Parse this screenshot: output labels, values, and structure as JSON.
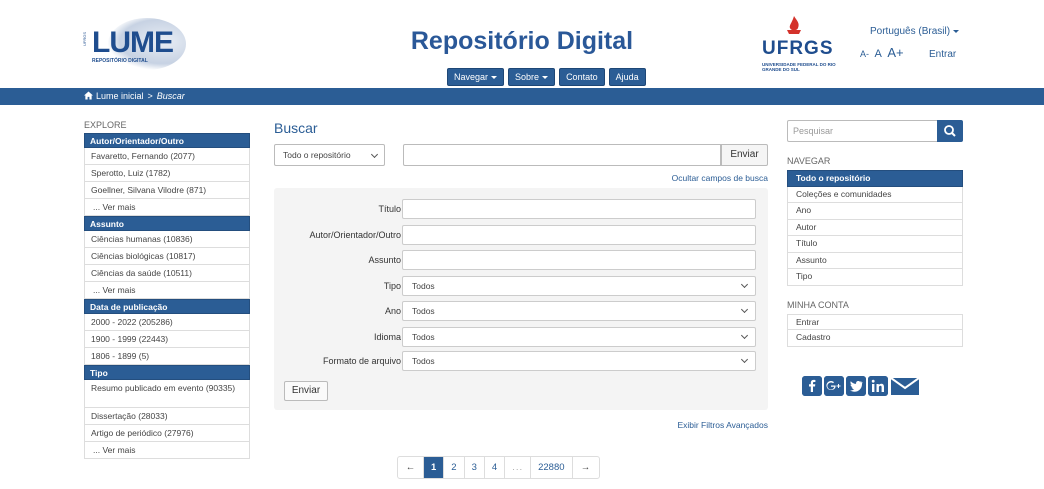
{
  "header": {
    "logo": {
      "word": "LUME",
      "subtitle": "REPOSITÓRIO DIGITAL",
      "vertical": "UFRGS"
    },
    "site_title": "Repositório Digital",
    "nav": [
      {
        "label": "Navegar",
        "dropdown": true
      },
      {
        "label": "Sobre",
        "dropdown": true
      },
      {
        "label": "Contato",
        "dropdown": false
      },
      {
        "label": "Ajuda",
        "dropdown": false
      }
    ],
    "ufrgs": {
      "word": "UFRGS",
      "subtitle": "UNIVERSIDADE FEDERAL DO RIO GRANDE DO SUL"
    },
    "language": "Português (Brasil)",
    "font_sizes": [
      "A-",
      "A",
      "A+"
    ],
    "login": "Entrar"
  },
  "breadcrumb": {
    "home": "Lume inicial",
    "separator": ">",
    "current": "Buscar"
  },
  "left_sidebar": {
    "heading": "EXPLORE",
    "facets": [
      {
        "title": "Autor/Orientador/Outro",
        "items": [
          "Favaretto, Fernando (2077)",
          "Sperotto, Luiz (1782)",
          "Goellner, Silvana Vilodre (871)"
        ],
        "more": "... Ver mais"
      },
      {
        "title": "Assunto",
        "items": [
          "Ciências humanas (10836)",
          "Ciências biológicas (10817)",
          "Ciências da saúde (10511)"
        ],
        "more": "... Ver mais"
      },
      {
        "title": "Data de publicação",
        "items": [
          "2000 - 2022 (205286)",
          "1900 - 1999 (22443)",
          "1806 - 1899 (5)"
        ],
        "more": null
      },
      {
        "title": "Tipo",
        "items": [
          "Resumo publicado em evento (90335)",
          "Dissertação (28033)",
          "Artigo de periódico (27976)"
        ],
        "more": "... Ver mais"
      }
    ]
  },
  "main": {
    "heading": "Buscar",
    "scope": "Todo o repositório",
    "query_value": "",
    "submit": "Enviar",
    "hide_fields": "Ocultar campos de busca",
    "advanced": {
      "fields": [
        {
          "label": "Título",
          "type": "input",
          "value": ""
        },
        {
          "label": "Autor/Orientador/Outro",
          "type": "input",
          "value": ""
        },
        {
          "label": "Assunto",
          "type": "input",
          "value": ""
        },
        {
          "label": "Tipo",
          "type": "select",
          "value": "Todos"
        },
        {
          "label": "Ano",
          "type": "select",
          "value": "Todos"
        },
        {
          "label": "Idioma",
          "type": "select",
          "value": "Todos"
        },
        {
          "label": "Formato de arquivo",
          "type": "select",
          "value": "Todos"
        }
      ],
      "submit": "Enviar"
    },
    "advanced_filters": "Exibir Filtros Avançados",
    "pagination": {
      "prev": "←",
      "pages": [
        "1",
        "2",
        "3",
        "4"
      ],
      "dots": "...",
      "last": "22880",
      "next": "→",
      "active": "1"
    }
  },
  "right_sidebar": {
    "search_placeholder": "Pesquisar",
    "navigate_heading": "NAVEGAR",
    "navigate_items": [
      "Todo o repositório",
      "Coleções e comunidades",
      "Ano",
      "Autor",
      "Título",
      "Assunto",
      "Tipo"
    ],
    "account_heading": "MINHA CONTA",
    "account_items": [
      "Entrar",
      "Cadastro"
    ],
    "social": [
      "facebook-icon",
      "google-plus-icon",
      "twitter-icon",
      "linkedin-icon",
      "email-icon"
    ]
  },
  "colors": {
    "brand": "#2b5d95",
    "ufrgs_red": "#d4322b",
    "panel": "#f4f4f4"
  }
}
